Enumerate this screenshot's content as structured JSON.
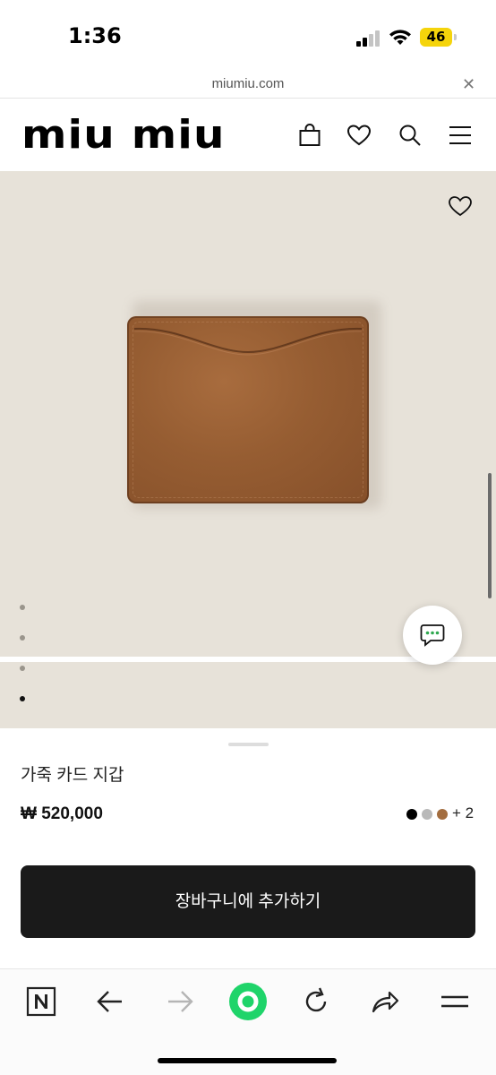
{
  "status_bar": {
    "time": "1:36",
    "battery_level": "46",
    "battery_color": "#f5d40b"
  },
  "browser": {
    "url": "miumiu.com",
    "close_icon": "close-icon"
  },
  "header": {
    "logo_text": "miu miu",
    "icons": [
      "shopping-bag-icon",
      "heart-icon",
      "search-icon",
      "menu-icon"
    ]
  },
  "product": {
    "gallery_image": "brown-leather-card-wallet",
    "image_background": "#e7e2d9",
    "gallery_dots_count": 4,
    "active_dot_index": 4,
    "name": "가죽 카드 지갑",
    "price": "₩ 520,000",
    "color_swatches": [
      "#000000",
      "#b9b9b9",
      "#a36d3f"
    ],
    "more_colors": "+ 2",
    "add_to_cart_label": "장바구니에 추가하기"
  },
  "chat": {
    "icon": "chat-bubble-icon",
    "accent_color": "#2fa84f"
  },
  "toolbar": {
    "icons": [
      "naver-n-icon",
      "back-arrow-icon",
      "forward-arrow-icon",
      "green-home-icon",
      "reload-icon",
      "share-icon",
      "menu-icon"
    ],
    "accent_color": "#1fd46a"
  }
}
